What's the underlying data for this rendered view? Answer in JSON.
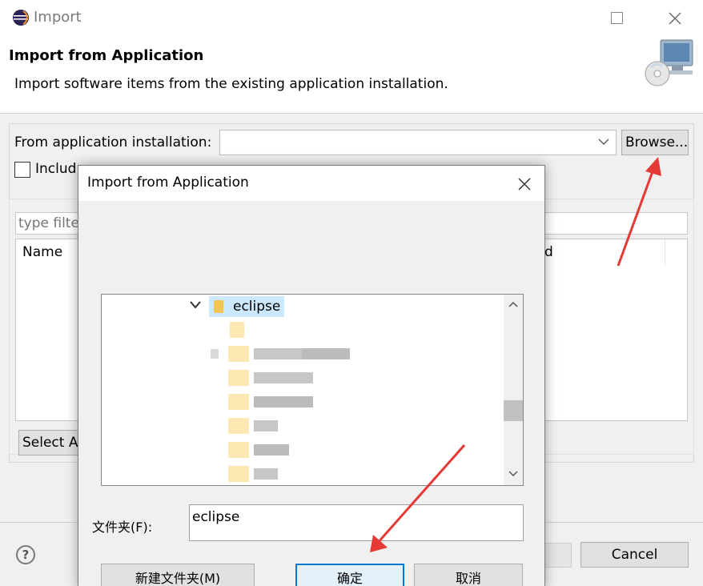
{
  "window": {
    "title": "Import",
    "buttons": {
      "maximize_icon": "maximize-icon",
      "close_icon": "close-icon"
    }
  },
  "banner": {
    "title": "Import from Application",
    "description": "Import software items from the existing application installation.",
    "icon": "computer-cd-icon"
  },
  "form": {
    "from_label": "From application installation:",
    "install_value": "",
    "browse_label": "Browse...",
    "include_label": "Includ",
    "include_checked": false,
    "filter_placeholder": "type filte",
    "table": {
      "columns": [
        "Name",
        "d"
      ]
    },
    "select_all_label": "Select A"
  },
  "footer": {
    "help_glyph": "?",
    "cancel_label": "Cancel"
  },
  "folder_dialog": {
    "title": "Import from Application",
    "tree": {
      "selected_folder": "eclipse",
      "selected_expanded": true
    },
    "folder_label": "文件夹(F):",
    "folder_value": "eclipse",
    "new_folder_label": "新建文件夹(M)",
    "ok_label": "确定",
    "cancel_label": "取消"
  },
  "colors": {
    "annotation_arrow": "#e53935",
    "selection": "#cce8ff",
    "accent": "#0078d7"
  }
}
